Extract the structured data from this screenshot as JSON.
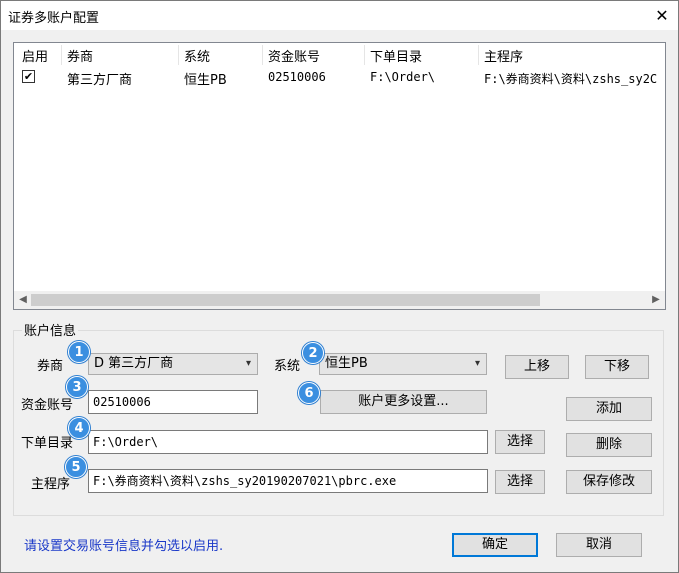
{
  "window": {
    "title": "证券多账户配置",
    "close_label": "✕"
  },
  "list": {
    "columns": [
      "启用",
      "券商",
      "系统",
      "资金账号",
      "下单目录",
      "主程序"
    ],
    "rows": [
      {
        "enabled": true,
        "check_mark": "✔",
        "broker": "第三方厂商",
        "system": "恒生PB",
        "account": "02510006",
        "order_dir": "F:\\Order\\",
        "main_program": "F:\\券商资料\\资料\\zshs_sy2C"
      }
    ],
    "scroll_left": "◀",
    "scroll_right": "▶"
  },
  "account_info": {
    "group_label": "账户信息",
    "broker_label": "券商",
    "broker_value": "D 第三方厂商",
    "system_label": "系统",
    "system_value": "恒生PB",
    "account_label": "资金账号",
    "account_value": "02510006",
    "order_dir_label": "下单目录",
    "order_dir_value": "F:\\Order\\",
    "main_program_label": "主程序",
    "main_program_value": "F:\\券商资料\\资料\\zshs_sy20190207021\\pbrc.exe",
    "more_settings_label": "账户更多设置...",
    "select_label": "选择",
    "move_up_label": "上移",
    "move_down_label": "下移",
    "add_label": "添加",
    "delete_label": "删除",
    "save_label": "保存修改",
    "dropdown_arrow": "▾"
  },
  "badges": [
    "1",
    "2",
    "3",
    "4",
    "5",
    "6"
  ],
  "footer": {
    "hint": "请设置交易账号信息并勾选以启用.",
    "ok_label": "确定",
    "cancel_label": "取消"
  },
  "colors": {
    "accent": "#0078d7",
    "hint": "#1a38c8",
    "badge": "#3b8fe0"
  }
}
